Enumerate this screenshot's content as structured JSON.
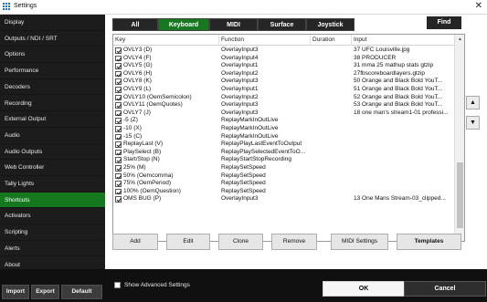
{
  "window": {
    "title": "Settings",
    "close_glyph": "✕"
  },
  "sidebar": {
    "items": [
      {
        "label": "Display"
      },
      {
        "label": "Outputs / NDI / SRT"
      },
      {
        "label": "Options"
      },
      {
        "label": "Performance"
      },
      {
        "label": "Decoders"
      },
      {
        "label": "Recording"
      },
      {
        "label": "External Output"
      },
      {
        "label": "Audio"
      },
      {
        "label": "Audio Outputs"
      },
      {
        "label": "Web Controller"
      },
      {
        "label": "Tally Lights"
      },
      {
        "label": "Shortcuts"
      },
      {
        "label": "Activators"
      },
      {
        "label": "Scripting"
      },
      {
        "label": "Alerts"
      },
      {
        "label": "About"
      }
    ],
    "active_index": 11,
    "buttons": {
      "import": "Import",
      "export": "Export",
      "default": "Default"
    }
  },
  "tabs": [
    {
      "label": "All"
    },
    {
      "label": "Keyboard"
    },
    {
      "label": "MIDI"
    },
    {
      "label": "Surface"
    },
    {
      "label": "Joystick"
    }
  ],
  "active_tab": 1,
  "find_label": "Find",
  "table": {
    "headers": {
      "key": "Key",
      "function": "Function",
      "duration": "Duration",
      "input": "Input"
    },
    "rows": [
      {
        "key": "OVLY3 (D)",
        "function": "OverlayInput3",
        "duration": "",
        "input": "37 UFC Louisville.jpg"
      },
      {
        "key": "OVLY4 (F)",
        "function": "OverlayInput4",
        "duration": "",
        "input": "38 PRODUCER"
      },
      {
        "key": "OVLY5 (G)",
        "function": "OverlayInput1",
        "duration": "",
        "input": "31 mma 25 mathup stats gtzip"
      },
      {
        "key": "OVLY6 (H)",
        "function": "OverlayInput2",
        "duration": "",
        "input": "27fbscoreboardlayers.gtzip"
      },
      {
        "key": "OVLY8 (K)",
        "function": "OverlayInput3",
        "duration": "",
        "input": "50 Orange and Black Bold YouT..."
      },
      {
        "key": "OVLY9 (L)",
        "function": "OverlayInput1",
        "duration": "",
        "input": "51 Orange and Black Bold YouT..."
      },
      {
        "key": "OVLY10 (OemSemicolon)",
        "function": "OverlayInput2",
        "duration": "",
        "input": "52 Orange and Black Bold YouT..."
      },
      {
        "key": "OVLY11 (OemQuotes)",
        "function": "OverlayInput3",
        "duration": "",
        "input": "53 Orange and Black Bold YouT..."
      },
      {
        "key": "OVLY7 (J)",
        "function": "OverlayInput3",
        "duration": "",
        "input": "18 one man's stream1-01 professi..."
      },
      {
        "key": "-5 (Z)",
        "function": "ReplayMarkInOutLive",
        "duration": "",
        "input": ""
      },
      {
        "key": "-10 (X)",
        "function": "ReplayMarkInOutLive",
        "duration": "",
        "input": ""
      },
      {
        "key": "-15 (C)",
        "function": "ReplayMarkInOutLive",
        "duration": "",
        "input": ""
      },
      {
        "key": "ReplayLast (V)",
        "function": "ReplayPlayLastEventToOutput",
        "duration": "",
        "input": ""
      },
      {
        "key": "PlaySelect (B)",
        "function": "ReplayPlaySelectedEventToO...",
        "duration": "",
        "input": ""
      },
      {
        "key": "Start/Stop (N)",
        "function": "ReplayStartStopRecording",
        "duration": "",
        "input": ""
      },
      {
        "key": "25% (M)",
        "function": "ReplaySetSpeed",
        "duration": "",
        "input": ""
      },
      {
        "key": "50% (Oemcomma)",
        "function": "ReplaySetSpeed",
        "duration": "",
        "input": ""
      },
      {
        "key": "75% (OemPeriod)",
        "function": "ReplaySetSpeed",
        "duration": "",
        "input": ""
      },
      {
        "key": "100% (OemQuestion)",
        "function": "ReplaySetSpeed",
        "duration": "",
        "input": ""
      },
      {
        "key": "OMS BUG (P)",
        "function": "OverlayInput3",
        "duration": "",
        "input": "13 One Mans Stream-03_clipped..."
      }
    ]
  },
  "scroll": {
    "up_glyph": "▲",
    "down_glyph": "▼"
  },
  "move_buttons": {
    "up": "▲",
    "down": "▼"
  },
  "actions": {
    "add": "Add",
    "edit": "Edit",
    "clone": "Clone",
    "remove": "Remove",
    "midi_settings": "MIDI Settings",
    "templates": "Templates"
  },
  "footer": {
    "show_advanced": "Show Advanced Settings",
    "ok": "OK",
    "cancel": "Cancel"
  },
  "colors": {
    "accent_green": "#15781f",
    "sidebar_bg": "#1c1c1c",
    "footer_bg": "#101010"
  }
}
